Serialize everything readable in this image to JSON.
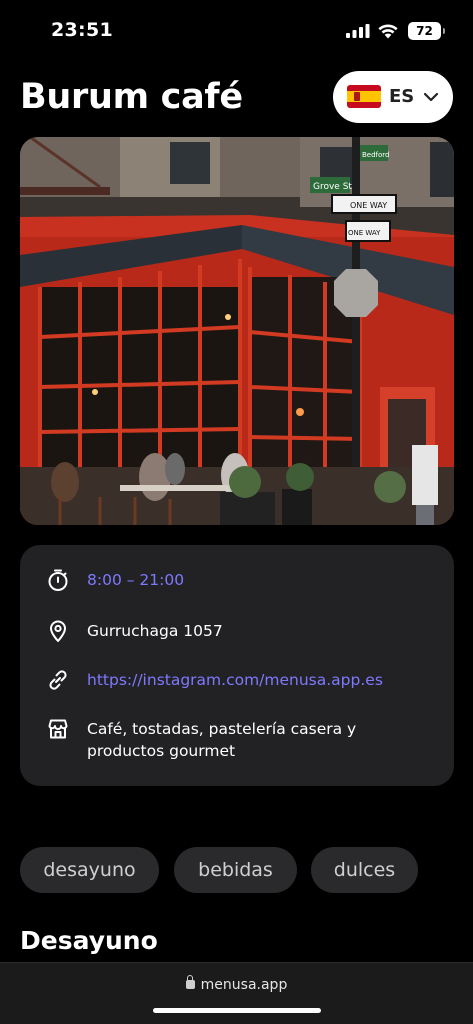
{
  "status_bar": {
    "time": "23:51",
    "battery": "72"
  },
  "header": {
    "title": "Burum café"
  },
  "language": {
    "flag": "spain-flag",
    "code": "ES"
  },
  "hero": {
    "alt": ""
  },
  "info": {
    "hours": "8:00 – 21:00",
    "address": "Gurruchaga 1057",
    "link": "https://instagram.com/menusa.app.es",
    "description": "Café, tostadas, pastelería casera y productos gourmet"
  },
  "categories": [
    "desayuno",
    "bebidas",
    "dulces"
  ],
  "section": {
    "title": "Desayuno"
  },
  "browser": {
    "url": "menusa.app"
  },
  "colors": {
    "accent": "#7e79ff",
    "card": "#222224",
    "chip": "#2a2a2c"
  },
  "street_signs": {
    "grove": "Grove St",
    "oneway": "ONE WAY",
    "bedford": "Bedford"
  }
}
